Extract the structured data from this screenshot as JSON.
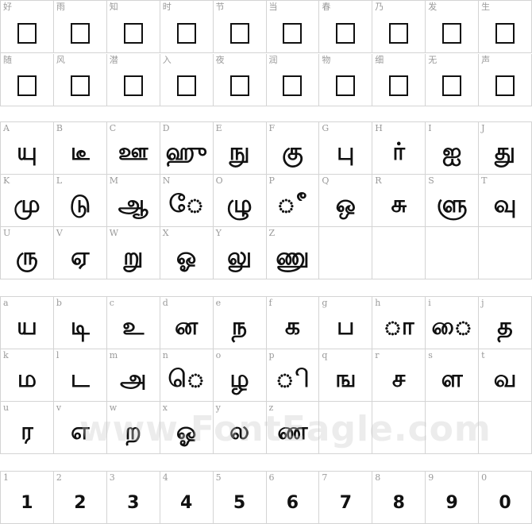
{
  "cjk": [
    {
      "label": "好"
    },
    {
      "label": "雨"
    },
    {
      "label": "知"
    },
    {
      "label": "时"
    },
    {
      "label": "节"
    },
    {
      "label": "当"
    },
    {
      "label": "春"
    },
    {
      "label": "乃"
    },
    {
      "label": "发"
    },
    {
      "label": "生"
    },
    {
      "label": "随"
    },
    {
      "label": "风"
    },
    {
      "label": "潜"
    },
    {
      "label": "入"
    },
    {
      "label": "夜"
    },
    {
      "label": "润"
    },
    {
      "label": "物"
    },
    {
      "label": "细"
    },
    {
      "label": "无"
    },
    {
      "label": "声"
    }
  ],
  "upper": [
    {
      "label": "A",
      "glyph": "யு"
    },
    {
      "label": "B",
      "glyph": "டீ"
    },
    {
      "label": "C",
      "glyph": "ஊ"
    },
    {
      "label": "D",
      "glyph": "ஹு"
    },
    {
      "label": "E",
      "glyph": "நு"
    },
    {
      "label": "F",
      "glyph": "கு"
    },
    {
      "label": "G",
      "glyph": "பு"
    },
    {
      "label": "H",
      "glyph": "ர்"
    },
    {
      "label": "I",
      "glyph": "ஐ"
    },
    {
      "label": "J",
      "glyph": "து"
    },
    {
      "label": "K",
      "glyph": "மு"
    },
    {
      "label": "L",
      "glyph": "டு"
    },
    {
      "label": "M",
      "glyph": "ஆ"
    },
    {
      "label": "N",
      "glyph": "ே"
    },
    {
      "label": "O",
      "glyph": "ழு"
    },
    {
      "label": "P",
      "glyph": "ீ"
    },
    {
      "label": "Q",
      "glyph": "ஒ"
    },
    {
      "label": "R",
      "glyph": "சு"
    },
    {
      "label": "S",
      "glyph": "ளு"
    },
    {
      "label": "T",
      "glyph": "வு"
    },
    {
      "label": "U",
      "glyph": "ரு"
    },
    {
      "label": "V",
      "glyph": "ஏ"
    },
    {
      "label": "W",
      "glyph": "று"
    },
    {
      "label": "X",
      "glyph": "ஓ"
    },
    {
      "label": "Y",
      "glyph": "லு"
    },
    {
      "label": "Z",
      "glyph": "ணு"
    },
    {
      "label": "",
      "glyph": ""
    },
    {
      "label": "",
      "glyph": ""
    },
    {
      "label": "",
      "glyph": ""
    },
    {
      "label": "",
      "glyph": ""
    }
  ],
  "lower": [
    {
      "label": "a",
      "glyph": "ய"
    },
    {
      "label": "b",
      "glyph": "டி"
    },
    {
      "label": "c",
      "glyph": "உ"
    },
    {
      "label": "d",
      "glyph": "ன"
    },
    {
      "label": "e",
      "glyph": "ந"
    },
    {
      "label": "f",
      "glyph": "க"
    },
    {
      "label": "g",
      "glyph": "ப"
    },
    {
      "label": "h",
      "glyph": "ா"
    },
    {
      "label": "i",
      "glyph": "ை"
    },
    {
      "label": "j",
      "glyph": "த"
    },
    {
      "label": "k",
      "glyph": "ம"
    },
    {
      "label": "l",
      "glyph": "ட"
    },
    {
      "label": "m",
      "glyph": "அ"
    },
    {
      "label": "n",
      "glyph": "ெ"
    },
    {
      "label": "o",
      "glyph": "ழ"
    },
    {
      "label": "p",
      "glyph": "ி"
    },
    {
      "label": "q",
      "glyph": "ங"
    },
    {
      "label": "r",
      "glyph": "ச"
    },
    {
      "label": "s",
      "glyph": "ள"
    },
    {
      "label": "t",
      "glyph": "வ"
    },
    {
      "label": "u",
      "glyph": "ர"
    },
    {
      "label": "v",
      "glyph": "எ"
    },
    {
      "label": "w",
      "glyph": "ற"
    },
    {
      "label": "x",
      "glyph": "ஓ"
    },
    {
      "label": "y",
      "glyph": "ல"
    },
    {
      "label": "z",
      "glyph": "ண"
    },
    {
      "label": "",
      "glyph": ""
    },
    {
      "label": "",
      "glyph": ""
    },
    {
      "label": "",
      "glyph": ""
    },
    {
      "label": "",
      "glyph": ""
    }
  ],
  "digits": [
    {
      "label": "1",
      "glyph": "1"
    },
    {
      "label": "2",
      "glyph": "2"
    },
    {
      "label": "3",
      "glyph": "3"
    },
    {
      "label": "4",
      "glyph": "4"
    },
    {
      "label": "5",
      "glyph": "5"
    },
    {
      "label": "6",
      "glyph": "6"
    },
    {
      "label": "7",
      "glyph": "7"
    },
    {
      "label": "8",
      "glyph": "8"
    },
    {
      "label": "9",
      "glyph": "9"
    },
    {
      "label": "0",
      "glyph": "0"
    }
  ],
  "watermark": "www.FontEagle.com"
}
